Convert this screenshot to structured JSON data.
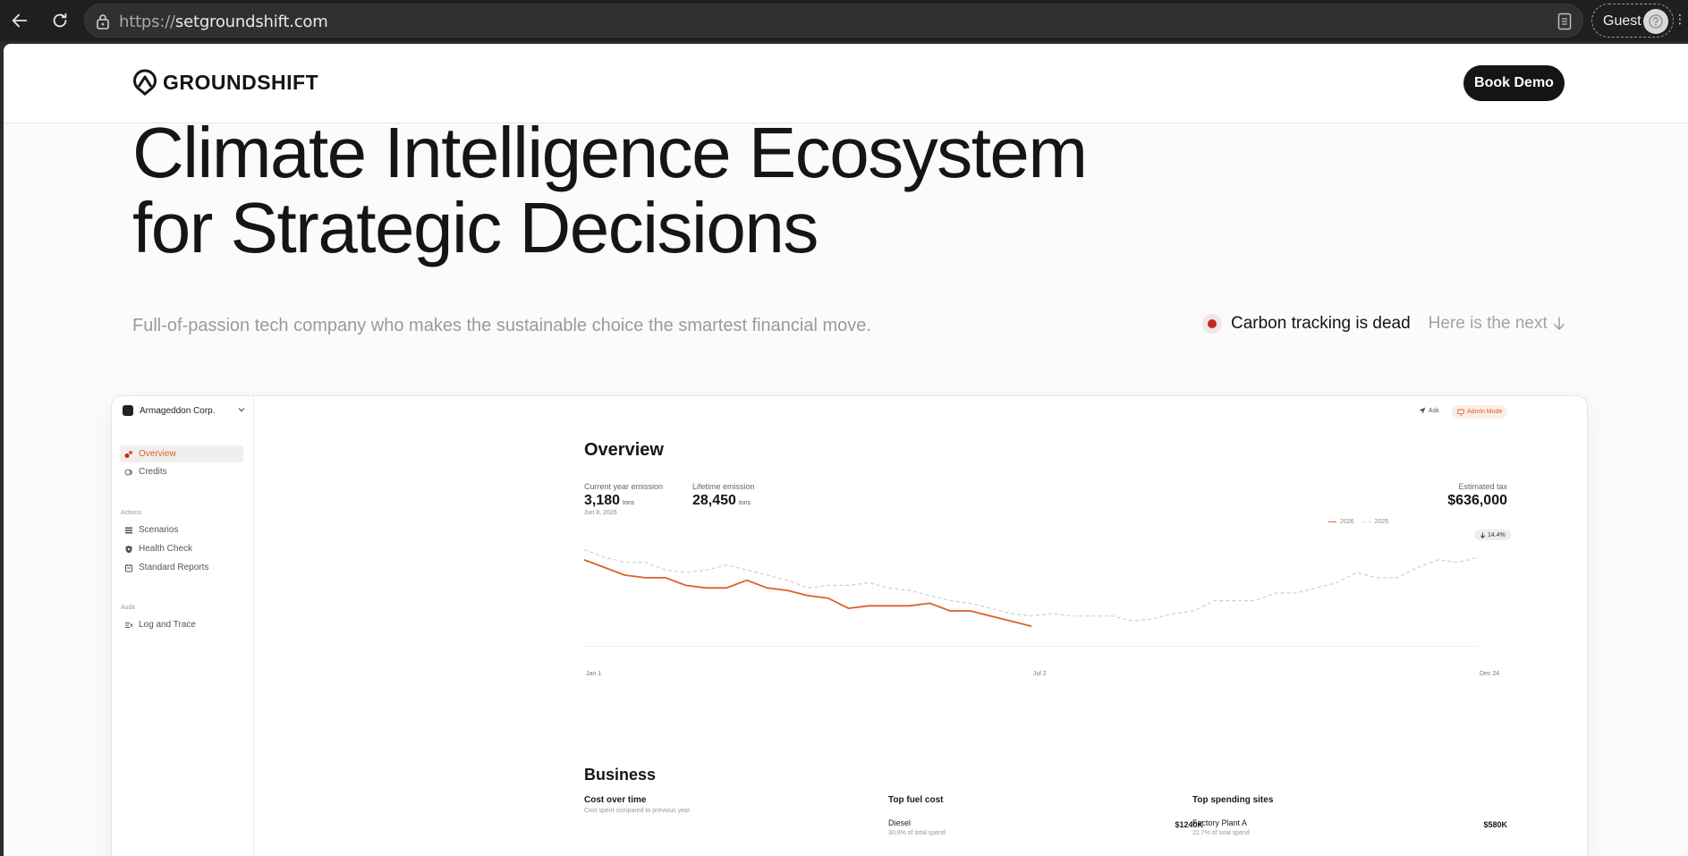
{
  "browser": {
    "url_protocol": "https://",
    "url_host": "setgroundshift.com",
    "profile_label": "Guest"
  },
  "header": {
    "brand": "GROUNDSHIFT",
    "cta_label": "Book Demo"
  },
  "hero": {
    "title_line1": "Climate Intelligence Ecosystem",
    "title_line2": "for Strategic Decisions",
    "subtitle": "Full-of-passion tech company who makes the sustainable choice the smartest financial move.",
    "status_text": "Carbon tracking is dead",
    "next_text": "Here is the next"
  },
  "app": {
    "org_name": "Armageddon Corp.",
    "nav": {
      "overview": "Overview",
      "credits": "Credits",
      "actions_section": "Actions",
      "scenarios": "Scenarios",
      "health_check": "Health Check",
      "standard_reports": "Standard Reports",
      "audit_section": "Audit",
      "log_trace": "Log and Trace"
    },
    "topbar": {
      "ask": "Ask",
      "admin_mode": "Admin Mode"
    },
    "overview": {
      "title": "Overview",
      "current_label": "Current year emission",
      "current_value": "3,180",
      "current_unit": "tons",
      "current_date": "Jun 8, 2026",
      "lifetime_label": "Lifetime emission",
      "lifetime_value": "28,450",
      "lifetime_unit": "tons",
      "tax_label": "Estimated tax",
      "tax_value": "$636,000",
      "tax_change": "14.4%"
    },
    "business": {
      "title": "Business",
      "cost_title": "Cost over time",
      "cost_sub": "Cost spent compared to previous year.",
      "fuel_title": "Top fuel cost",
      "fuel_item": "Diesel",
      "fuel_share": "30.8% of total spend",
      "fuel_value": "$1240K",
      "sites_title": "Top spending sites",
      "site_item": "Factory Plant A",
      "site_share": "22.7% of total spend",
      "site_value": "$580K"
    }
  },
  "chart_data": {
    "type": "line",
    "x_tick_labels": [
      "Jan 1",
      "Jul 2",
      "Dec 24"
    ],
    "legend": [
      "2026",
      "2025"
    ],
    "series": [
      {
        "name": "2026",
        "color": "#d9622b",
        "style": "solid",
        "values": [
          96,
          93,
          90,
          89,
          89,
          86,
          85,
          85,
          88,
          85,
          84,
          82,
          81,
          77,
          78,
          78,
          78,
          79,
          76,
          76,
          74,
          72,
          70
        ]
      },
      {
        "name": "2025",
        "color": "#cfcfcf",
        "style": "dashed",
        "values": [
          100,
          97,
          95,
          95,
          92,
          91,
          92,
          94,
          92,
          90,
          88,
          85,
          86,
          86,
          87,
          85,
          84,
          82,
          80,
          79,
          77,
          75,
          74,
          75,
          74,
          74,
          74,
          72,
          73,
          75,
          76,
          80,
          80,
          80,
          83,
          83,
          85,
          87,
          91,
          89,
          89,
          93,
          96,
          95,
          97
        ]
      }
    ],
    "grid": false
  }
}
